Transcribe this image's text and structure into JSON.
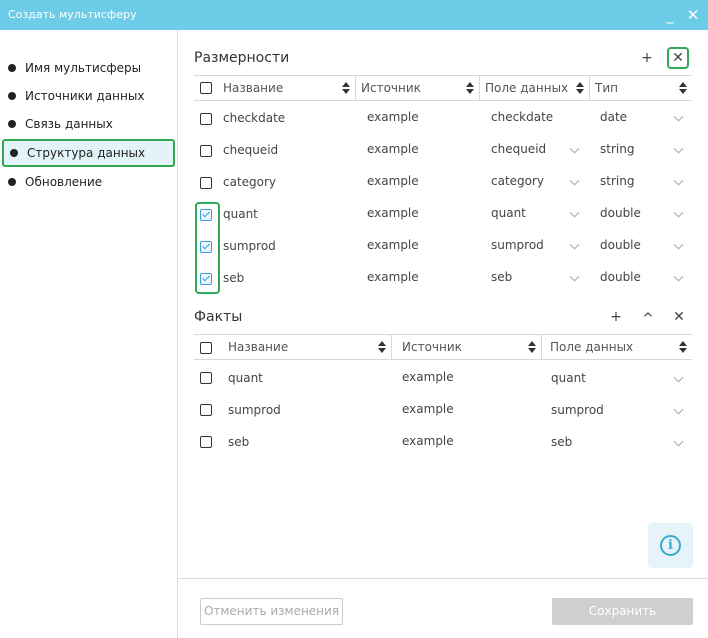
{
  "window": {
    "title": "Создать мультисферу",
    "minimize": "_",
    "close": "✕"
  },
  "sidebar": {
    "items": [
      {
        "label": "Имя мультисферы",
        "active": false
      },
      {
        "label": "Источники данных",
        "active": false
      },
      {
        "label": "Связь данных",
        "active": false
      },
      {
        "label": "Структура данных",
        "active": true
      },
      {
        "label": "Обновление",
        "active": false
      }
    ]
  },
  "dimensions": {
    "title": "Размерности",
    "add": "+",
    "remove": "✕",
    "headers": {
      "name": "Название",
      "source": "Источник",
      "field": "Поле данных",
      "type": "Тип"
    },
    "rows": [
      {
        "name": "checkdate",
        "source": "example",
        "field": "checkdate",
        "type": "date",
        "checked": false
      },
      {
        "name": "chequeid",
        "source": "example",
        "field": "chequeid",
        "type": "string",
        "checked": false
      },
      {
        "name": "category",
        "source": "example",
        "field": "category",
        "type": "string",
        "checked": false
      },
      {
        "name": "quant",
        "source": "example",
        "field": "quant",
        "type": "double",
        "checked": true
      },
      {
        "name": "sumprod",
        "source": "example",
        "field": "sumprod",
        "type": "double",
        "checked": true
      },
      {
        "name": "seb",
        "source": "example",
        "field": "seb",
        "type": "double",
        "checked": true
      }
    ]
  },
  "facts": {
    "title": "Факты",
    "add": "+",
    "up": "^",
    "remove": "✕",
    "headers": {
      "name": "Название",
      "source": "Источник",
      "field": "Поле данных"
    },
    "rows": [
      {
        "name": "quant",
        "source": "example",
        "field": "quant",
        "checked": false
      },
      {
        "name": "sumprod",
        "source": "example",
        "field": "sumprod",
        "checked": false
      },
      {
        "name": "seb",
        "source": "example",
        "field": "seb",
        "checked": false
      }
    ]
  },
  "info": {
    "icon": "i"
  },
  "footer": {
    "revert_label": "Отменить изменения",
    "save_label": "Сохранить"
  }
}
